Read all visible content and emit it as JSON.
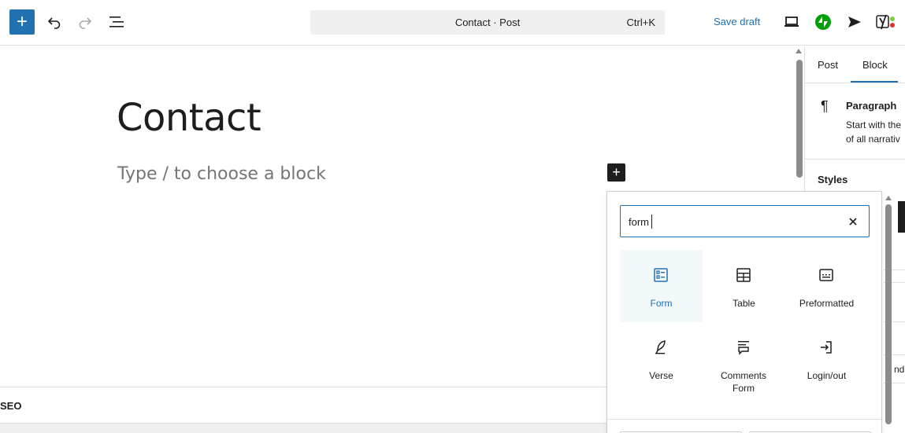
{
  "toolbar": {
    "inserter_symbol": "+",
    "undo_icon": "undo-icon",
    "redo_icon": "redo-icon",
    "list_view_icon": "list-view-icon",
    "command_bar": {
      "title": "Contact · Post",
      "shortcut": "Ctrl+K"
    },
    "save_draft_label": "Save draft",
    "preview_icon": "laptop-icon",
    "jetpack_icon": "jetpack-icon",
    "publish_icon": "send-icon",
    "yoast_icon": "yoast-icon"
  },
  "canvas": {
    "post_title": "Contact",
    "block_placeholder": "Type / to choose a block",
    "block_plus_symbol": "+"
  },
  "metabox": {
    "label": "SEO"
  },
  "sidebar": {
    "tabs": [
      {
        "label": "Post",
        "active": false
      },
      {
        "label": "Block",
        "active": true
      }
    ],
    "block_card": {
      "icon": "¶",
      "name": "Paragraph",
      "description_line1": "Start with the",
      "description_line2": "of all narrativ"
    },
    "styles_heading": "Styles",
    "truncated_text": "nd"
  },
  "inserter": {
    "search_value": "form",
    "clear_icon": "close-icon",
    "blocks": [
      {
        "label": "Form",
        "icon": "form-icon",
        "selected": true
      },
      {
        "label": "Table",
        "icon": "table-icon",
        "selected": false
      },
      {
        "label": "Preformatted",
        "icon": "preformatted-icon",
        "selected": false
      },
      {
        "label": "Verse",
        "icon": "verse-icon",
        "selected": false
      },
      {
        "label": "Comments Form",
        "icon": "comments-form-icon",
        "selected": false
      },
      {
        "label": "Login/out",
        "icon": "login-icon",
        "selected": false
      }
    ]
  },
  "colors": {
    "accent": "#2271b1",
    "text": "#1e1e1e",
    "placeholder": "#757575",
    "selected_block_bg": "#f3f8fb",
    "jetpack_green": "#069e08"
  }
}
